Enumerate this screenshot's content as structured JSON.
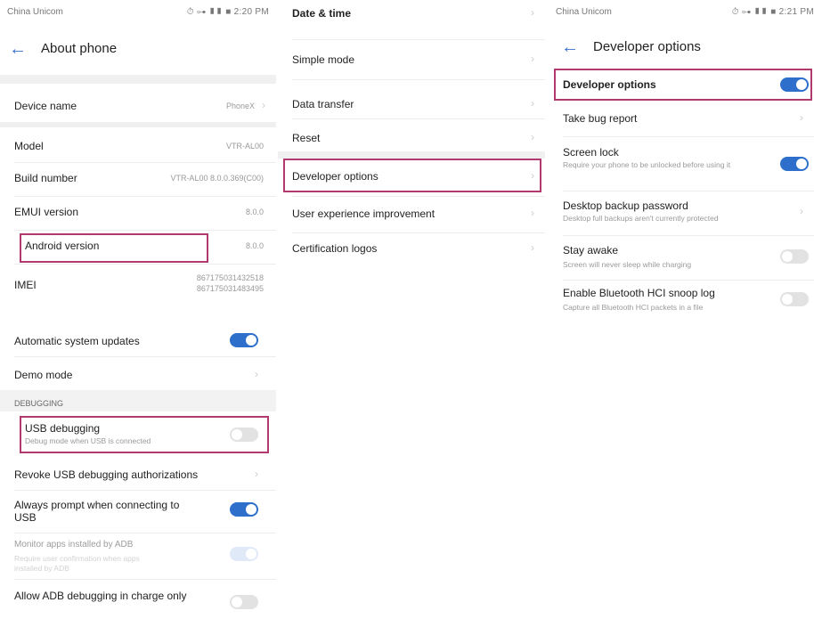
{
  "left": {
    "status": {
      "carrier": "China Unicom",
      "right": "⏱ ⊶ ▮▮ ■ 2:20 PM"
    },
    "title": "About phone",
    "rows": [
      {
        "label": "Device name",
        "value": "PhoneX"
      },
      {
        "label": "Model",
        "value": "VTR-AL00"
      },
      {
        "label": "Build number",
        "value": "VTR-AL00 8.0.0.369(C00)"
      },
      {
        "label": "EMUI version",
        "value": "8.0.0"
      },
      {
        "label": "Android version",
        "value": "8.0.0"
      },
      {
        "label": "IMEI",
        "value": "867175031432518",
        "value2": "867175031483495"
      }
    ]
  },
  "middle": {
    "rows": [
      {
        "label": "Date & time"
      },
      {
        "label": "Simple mode"
      },
      {
        "label": "Data transfer"
      },
      {
        "label": "Reset"
      },
      {
        "label": "Developer options"
      },
      {
        "label": "User experience improvement"
      },
      {
        "label": "Certification logos"
      }
    ]
  },
  "right": {
    "status": {
      "carrier": "China Unicom",
      "right": "⏱ ⊶ ▮▮ ■ 2:21 PM"
    },
    "title": "Developer options",
    "rows": [
      {
        "label": "Developer options"
      },
      {
        "label": "Take bug report"
      },
      {
        "label": "Screen lock",
        "sub": "Require your phone to be unlocked before using it"
      },
      {
        "label": "Desktop backup password",
        "sub": "Desktop full backups aren't currently protected"
      },
      {
        "label": "Stay awake",
        "sub": "Screen will never sleep while charging"
      },
      {
        "label": "Enable Bluetooth HCI snoop log",
        "sub": "Capture all Bluetooth HCI packets in a file"
      }
    ]
  },
  "bottom": {
    "rows": [
      {
        "label": "Automatic system updates"
      },
      {
        "label": "Demo mode"
      }
    ],
    "section": "DEBUGGING",
    "usb": {
      "label": "USB debugging",
      "sub": "Debug mode when USB is connected"
    },
    "revoke": "Revoke USB debugging authorizations",
    "prompt": {
      "line1": "Always prompt when connecting to",
      "line2": "USB"
    },
    "monitor": {
      "line1": "Monitor apps installed by ADB",
      "sub1": "Require user confirmation when apps",
      "sub2": "installed by ADB"
    },
    "allow": "Allow ADB debugging in charge only"
  }
}
